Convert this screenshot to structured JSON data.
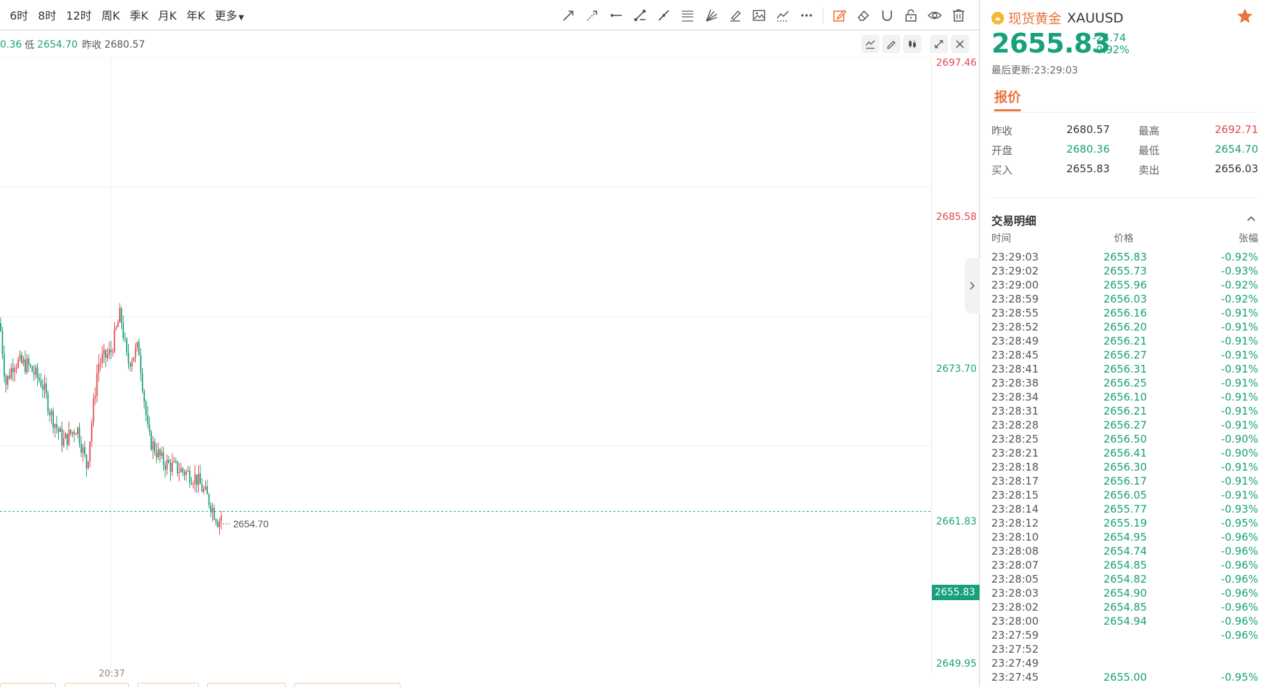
{
  "toolbar": {
    "periods": [
      "6时",
      "8时",
      "12时",
      "周K",
      "季K",
      "月K",
      "年K"
    ],
    "more_label": "更多"
  },
  "infobar": {
    "open_fragment": "0.36",
    "low_label": "低",
    "low_value": "2654.70",
    "prev_close_label": "昨收",
    "prev_close_value": "2680.57"
  },
  "price_axis": {
    "labels": [
      {
        "text": "2697.46",
        "color": "#e0474c"
      },
      {
        "text": "2685.58",
        "color": "#e0474c"
      },
      {
        "text": "2673.70",
        "color": "#17a07b"
      },
      {
        "text": "2661.83",
        "color": "#17a07b"
      },
      {
        "text": "2649.95",
        "color": "#17a07b"
      }
    ],
    "current": "2655.83"
  },
  "chart": {
    "low_marker": "2654.70",
    "time_label": "20:37",
    "up_color": "#e0474c",
    "down_color": "#17a07b"
  },
  "quote": {
    "name_cn": "现货黄金",
    "code": "XAUUSD",
    "price": "2655.83",
    "change": "-24.74",
    "change_pct": "-0.92%",
    "updated": "最后更新:23:29:03",
    "tab_label": "报价",
    "rows": [
      {
        "l1": "昨收",
        "v1": "2680.57",
        "c1": "blk",
        "l2": "最高",
        "v2": "2692.71",
        "c2": "red"
      },
      {
        "l1": "开盘",
        "v1": "2680.36",
        "c1": "grn",
        "l2": "最低",
        "v2": "2654.70",
        "c2": "grn"
      },
      {
        "l1": "买入",
        "v1": "2655.83",
        "c1": "blk",
        "l2": "卖出",
        "v2": "2656.03",
        "c2": "blk"
      }
    ]
  },
  "trades": {
    "title": "交易明细",
    "col_time": "时间",
    "col_price": "价格",
    "col_change": "张幅",
    "rows": [
      [
        "23:29:03",
        "2655.83",
        "-0.92%"
      ],
      [
        "23:29:02",
        "2655.73",
        "-0.93%"
      ],
      [
        "23:29:00",
        "2655.96",
        "-0.92%"
      ],
      [
        "23:28:59",
        "2656.03",
        "-0.92%"
      ],
      [
        "23:28:55",
        "2656.16",
        "-0.91%"
      ],
      [
        "23:28:52",
        "2656.20",
        "-0.91%"
      ],
      [
        "23:28:49",
        "2656.21",
        "-0.91%"
      ],
      [
        "23:28:45",
        "2656.27",
        "-0.91%"
      ],
      [
        "23:28:41",
        "2656.31",
        "-0.91%"
      ],
      [
        "23:28:38",
        "2656.25",
        "-0.91%"
      ],
      [
        "23:28:34",
        "2656.10",
        "-0.91%"
      ],
      [
        "23:28:31",
        "2656.21",
        "-0.91%"
      ],
      [
        "23:28:28",
        "2656.27",
        "-0.91%"
      ],
      [
        "23:28:25",
        "2656.50",
        "-0.90%"
      ],
      [
        "23:28:21",
        "2656.41",
        "-0.90%"
      ],
      [
        "23:28:18",
        "2656.30",
        "-0.91%"
      ],
      [
        "23:28:17",
        "2656.17",
        "-0.91%"
      ],
      [
        "23:28:15",
        "2656.05",
        "-0.91%"
      ],
      [
        "23:28:14",
        "2655.77",
        "-0.93%"
      ],
      [
        "23:28:12",
        "2655.19",
        "-0.95%"
      ],
      [
        "23:28:10",
        "2654.95",
        "-0.96%"
      ],
      [
        "23:28:08",
        "2654.74",
        "-0.96%"
      ],
      [
        "23:28:07",
        "2654.85",
        "-0.96%"
      ],
      [
        "23:28:05",
        "2654.82",
        "-0.96%"
      ],
      [
        "23:28:03",
        "2654.90",
        "-0.96%"
      ],
      [
        "23:28:02",
        "2654.85",
        "-0.96%"
      ],
      [
        "23:28:00",
        "2654.94",
        "-0.96%"
      ],
      [
        "23:27:59",
        "",
        "-0.96%"
      ],
      [
        "23:27:52",
        "",
        ""
      ],
      [
        "23:27:49",
        "",
        ""
      ],
      [
        "23:27:45",
        "2655.00",
        "-0.95%"
      ]
    ]
  }
}
